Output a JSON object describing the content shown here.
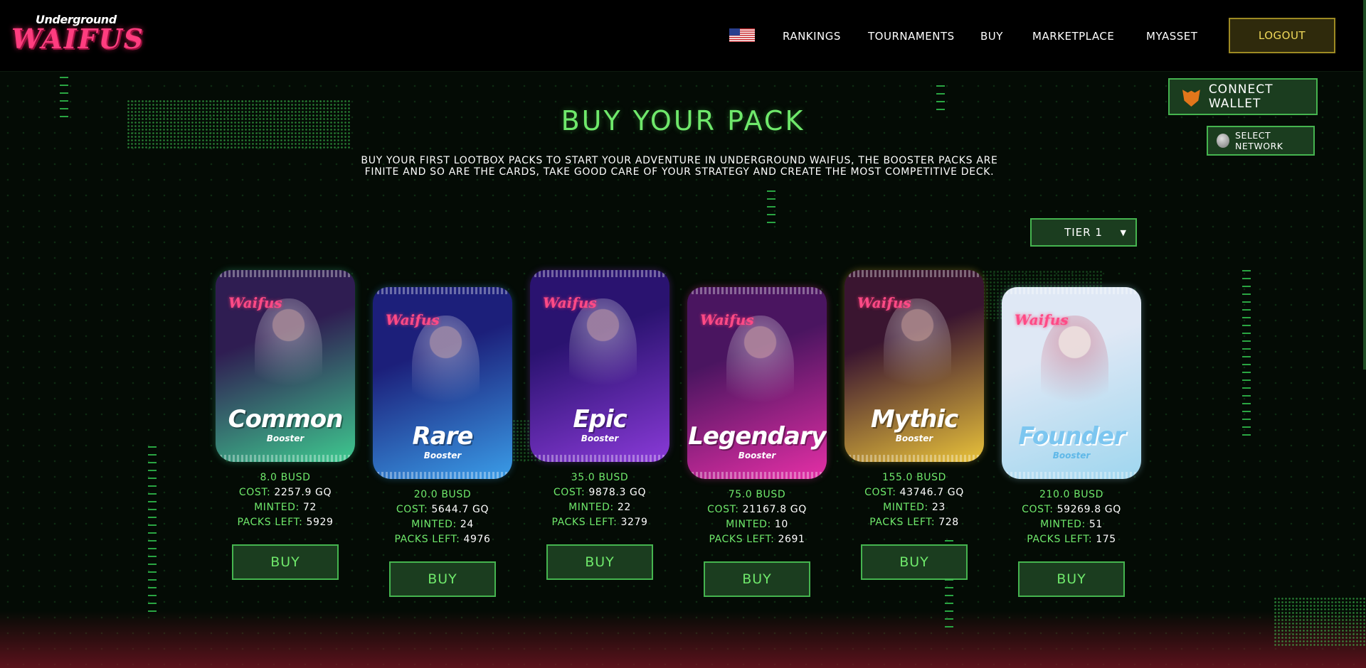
{
  "header": {
    "logo_top": "Underground",
    "logo_main": "WAIFUS",
    "nav": [
      "RANKINGS",
      "TOURNAMENTS",
      "BUY",
      "MARKETPLACE",
      "MYASSET"
    ],
    "flag_icon": "us-flag-icon",
    "logout_label": "LOGOUT"
  },
  "wallet": {
    "connect_label": "CONNECT WALLET",
    "network_label": "SELECT NETWORK"
  },
  "hero": {
    "title": "BUY YOUR PACK",
    "description": "BUY YOUR FIRST LOOTBOX PACKS TO START YOUR ADVENTURE IN UNDERGROUND WAIFUS, THE BOOSTER PACKS ARE FINITE AND SO ARE THE CARDS, TAKE GOOD CARE OF YOUR STRATEGY AND CREATE THE MOST COMPETITIVE DECK."
  },
  "tier_select": {
    "value": "TIER 1"
  },
  "labels": {
    "cost": "COST: ",
    "minted": "MINTED: ",
    "packs_left": "PACKS LEFT: ",
    "buy": "BUY",
    "booster": "Booster",
    "pack_logo": "Waifus"
  },
  "packs": [
    {
      "name": "Common",
      "price": "8.0 BUSD",
      "cost": "2257.9 GQ",
      "minted": "72",
      "packs_left": "5929",
      "colors": [
        "#2f1d52",
        "#3ec98f"
      ]
    },
    {
      "name": "Rare",
      "price": "20.0 BUSD",
      "cost": "5644.7 GQ",
      "minted": "24",
      "packs_left": "4976",
      "colors": [
        "#1c1f7a",
        "#3a9de8"
      ]
    },
    {
      "name": "Epic",
      "price": "35.0 BUSD",
      "cost": "9878.3 GQ",
      "minted": "22",
      "packs_left": "3279",
      "colors": [
        "#2a1370",
        "#8a3ad8"
      ]
    },
    {
      "name": "Legendary",
      "price": "75.0 BUSD",
      "cost": "21167.8 GQ",
      "minted": "10",
      "packs_left": "2691",
      "colors": [
        "#4a1560",
        "#e52fa6"
      ]
    },
    {
      "name": "Mythic",
      "price": "155.0 BUSD",
      "cost": "43746.7 GQ",
      "minted": "23",
      "packs_left": "728",
      "colors": [
        "#3a1530",
        "#e9c23a"
      ]
    },
    {
      "name": "Founder",
      "price": "210.0 BUSD",
      "cost": "59269.8 GQ",
      "minted": "51",
      "packs_left": "175",
      "colors": [
        "#dfe8f5",
        "#9fd6ef"
      ]
    }
  ]
}
